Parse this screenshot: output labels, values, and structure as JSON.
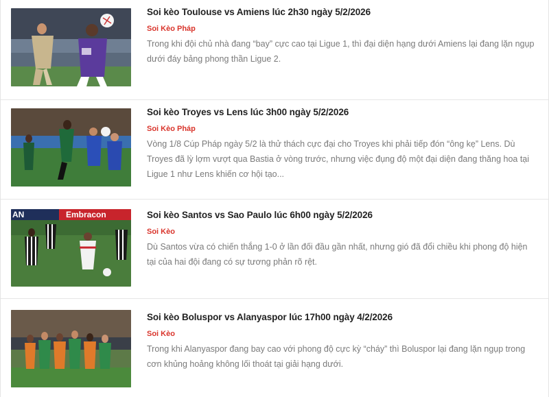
{
  "articles": [
    {
      "title": "Soi kèo Toulouse vs Amiens lúc 2h30 ngày 5/2/2026",
      "category": "Soi Kèo Pháp",
      "description": "Trong khi đội chủ nhà đang “bay” cực cao tại Ligue 1, thì đại diện hạng dưới Amiens lại đang lặn ngụp dưới đáy bảng phong thần Ligue 2."
    },
    {
      "title": "Soi kèo Troyes vs Lens lúc 3h00 ngày 5/2/2026",
      "category": "Soi Kèo Pháp",
      "description": "Vòng 1/8 Cúp Pháp ngày 5/2 là thử thách cực đại cho Troyes khi phải tiếp đón “ông kẹ” Lens. Dù Troyes đã lỳ lợm vượt qua Bastia ở vòng trước, nhưng việc đụng độ một đại diện đang thăng hoa tại Ligue 1 như Lens khiến cơ hội tạo..."
    },
    {
      "title": "Soi kèo Santos vs Sao Paulo lúc 6h00 ngày 5/2/2026",
      "category": "Soi Kèo",
      "description": "Dù Santos vừa có chiến thắng 1-0 ở lần đối đầu gần nhất, nhưng gió đã đổi chiều khi phong độ hiện tại của hai đội đang có sự tương phản rõ rệt.",
      "banner": "Embracon",
      "banner_left": "AN"
    },
    {
      "title": "Soi kèo Boluspor vs Alanyaspor lúc 17h00 ngày 4/2/2026",
      "category": "Soi Kèo",
      "description": "Trong khi Alanyaspor đang bay cao với phong độ cực kỳ “cháy” thì Boluspor lại đang lặn ngụp trong cơn khủng hoảng không lối thoát tại giải hạng dưới."
    }
  ],
  "colors": {
    "category": "#d9342b",
    "title": "#222222",
    "description": "#7a7a7a",
    "separator": "#e6e6e6"
  }
}
